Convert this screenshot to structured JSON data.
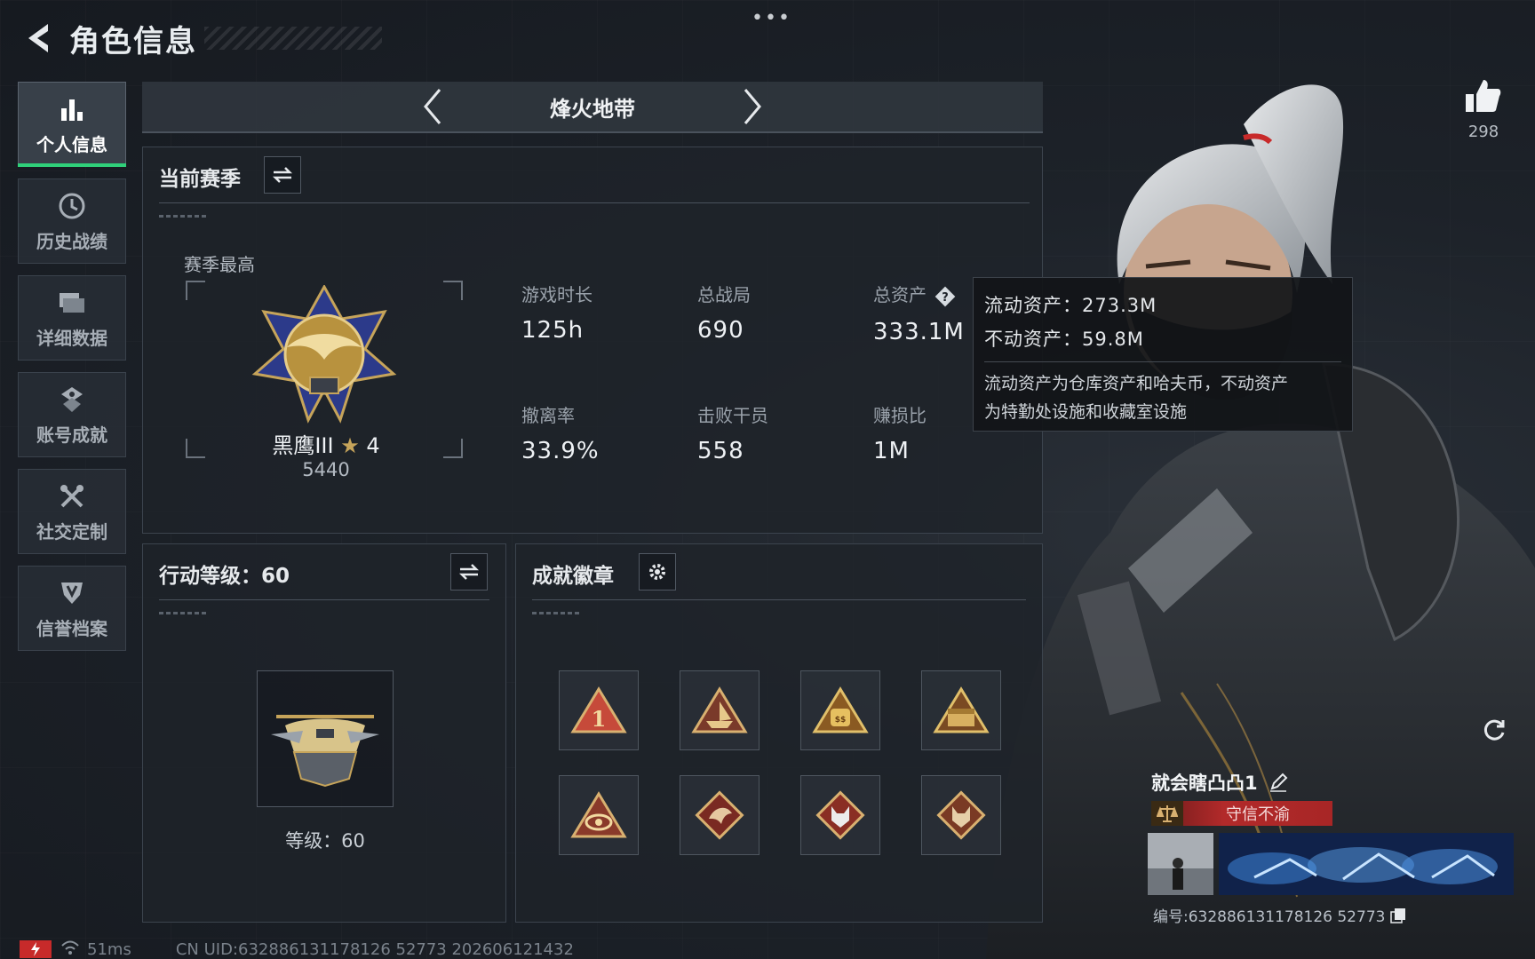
{
  "header": {
    "title": "角色信息",
    "more_label": "•••"
  },
  "nav": {
    "items": [
      {
        "label": "个人信息",
        "icon": "bar-chart-icon",
        "active": true
      },
      {
        "label": "历史战绩",
        "icon": "clock-icon"
      },
      {
        "label": "详细数据",
        "icon": "folder-icon"
      },
      {
        "label": "账号成就",
        "icon": "achievement-icon"
      },
      {
        "label": "社交定制",
        "icon": "tools-icon"
      },
      {
        "label": "信誉档案",
        "icon": "shield-icon"
      }
    ]
  },
  "mode_bar": {
    "label": "烽火地带"
  },
  "season": {
    "title": "当前赛季",
    "highest_label": "赛季最高",
    "rank_name": "黑鹰III",
    "rank_stars": "4",
    "rank_points": "5440",
    "stats": [
      {
        "label": "游戏时长",
        "value": "125h"
      },
      {
        "label": "总战局",
        "value": "690"
      },
      {
        "label": "总资产",
        "value": "333.1M"
      },
      {
        "label": "撤离率",
        "value": "33.9%"
      },
      {
        "label": "击败干员",
        "value": "558"
      },
      {
        "label": "赚损比",
        "value": "1M"
      }
    ]
  },
  "tooltip": {
    "liquid": "流动资产：273.3M",
    "fixed": "不动资产：59.8M",
    "desc_line1": "流动资产为仓库资产和哈夫币，不动资产",
    "desc_line2": "为特勤处设施和收藏室设施"
  },
  "action_level": {
    "title": "行动等级：60",
    "level_text": "等级：60"
  },
  "badges": {
    "title": "成就徽章",
    "items": [
      {
        "icon": "badge-1-icon"
      },
      {
        "icon": "badge-ship-icon"
      },
      {
        "icon": "badge-bag-icon"
      },
      {
        "icon": "badge-chest-icon"
      },
      {
        "icon": "badge-eye-icon"
      },
      {
        "icon": "badge-dragon-icon"
      },
      {
        "icon": "badge-wolf-icon"
      },
      {
        "icon": "badge-wolf2-icon"
      }
    ]
  },
  "player": {
    "like_count": "298",
    "name": "就会瞎凸凸1",
    "credit_status": "守信不渝",
    "uid_label": "编号:632886131178126 52773"
  },
  "status_bar": {
    "ping": "51ms",
    "uid_text": "CN UID:632886131178126 52773 202606121432"
  },
  "colors": {
    "accent_green": "#2fd07a",
    "credit_red": "#b22a2a",
    "bg": "#1a1f26"
  }
}
